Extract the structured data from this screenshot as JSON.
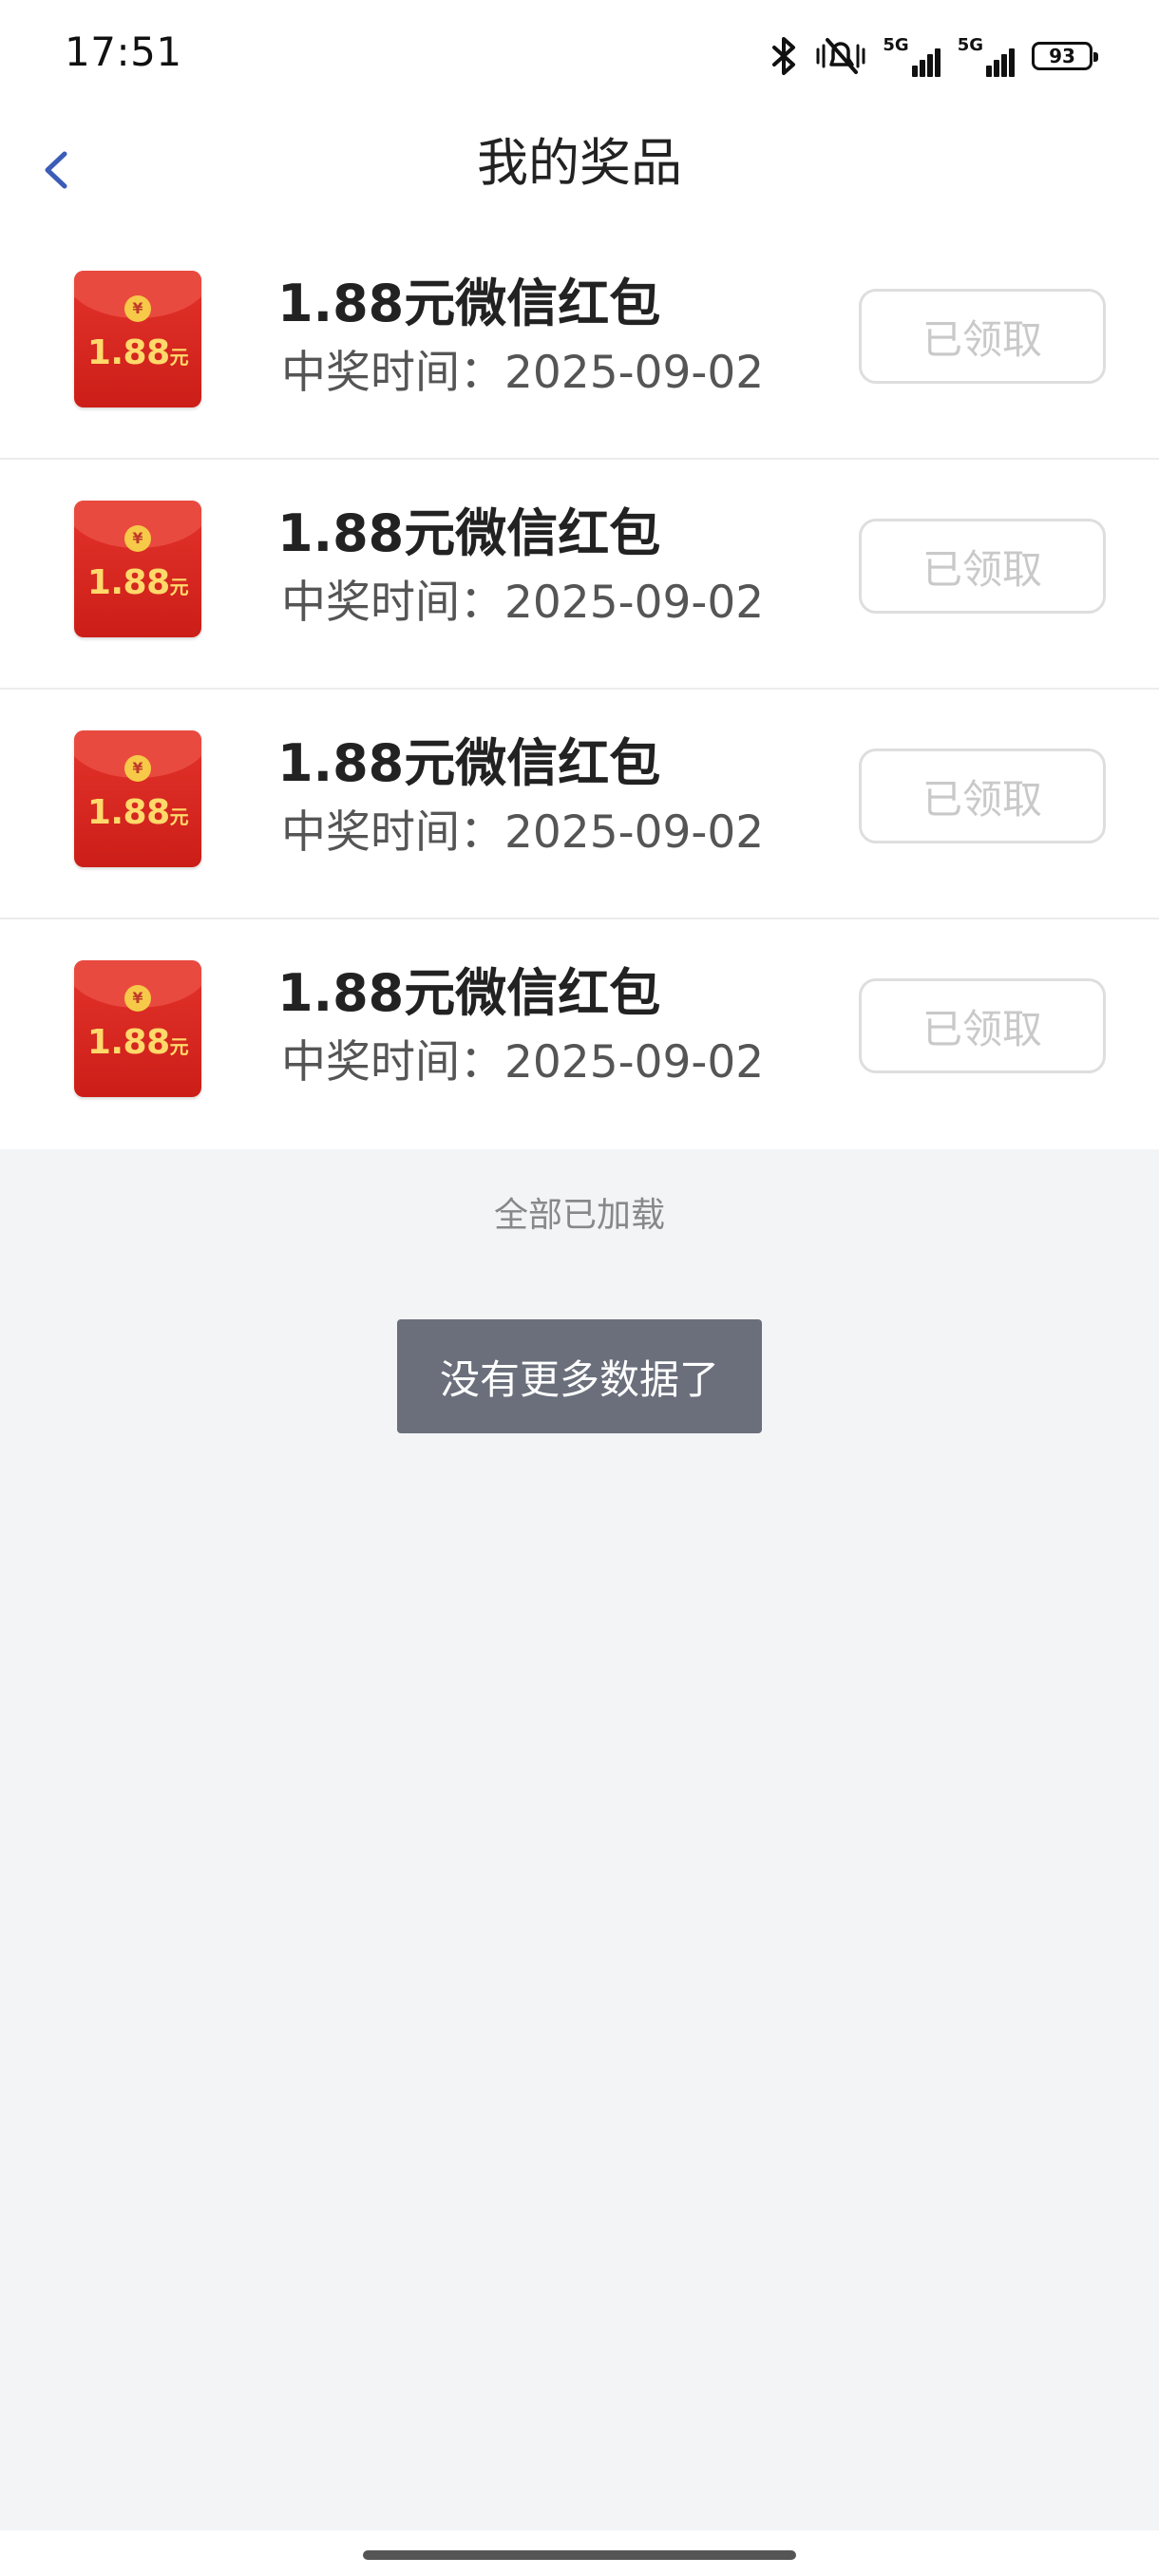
{
  "status_bar": {
    "time": "17:51",
    "icons": [
      "bluetooth-icon",
      "mute-icon",
      "signal-5g-icon",
      "signal-5g-icon",
      "battery-icon"
    ],
    "net1_label": "5G",
    "net2_label": "5G",
    "battery": "93"
  },
  "nav": {
    "back_icon": "chevron-left-icon",
    "title": "我的奖品"
  },
  "prizes": [
    {
      "envelope_amount": "1.88",
      "envelope_unit": "元",
      "title": "1.88元微信红包",
      "date": "中奖时间：2025-09-02",
      "button": "已领取"
    },
    {
      "envelope_amount": "1.88",
      "envelope_unit": "元",
      "title": "1.88元微信红包",
      "date": "中奖时间：2025-09-02",
      "button": "已领取"
    },
    {
      "envelope_amount": "1.88",
      "envelope_unit": "元",
      "title": "1.88元微信红包",
      "date": "中奖时间：2025-09-02",
      "button": "已领取"
    },
    {
      "envelope_amount": "1.88",
      "envelope_unit": "元",
      "title": "1.88元微信红包",
      "date": "中奖时间：2025-09-02",
      "button": "已领取"
    }
  ],
  "footer": {
    "loaded_text": "全部已加载",
    "toast": "没有更多数据了"
  },
  "colors": {
    "accent": "#3b5db7",
    "envelope_red": "#d9261f",
    "toast_bg": "#6a6f7b",
    "page_bg": "#f3f4f6"
  }
}
